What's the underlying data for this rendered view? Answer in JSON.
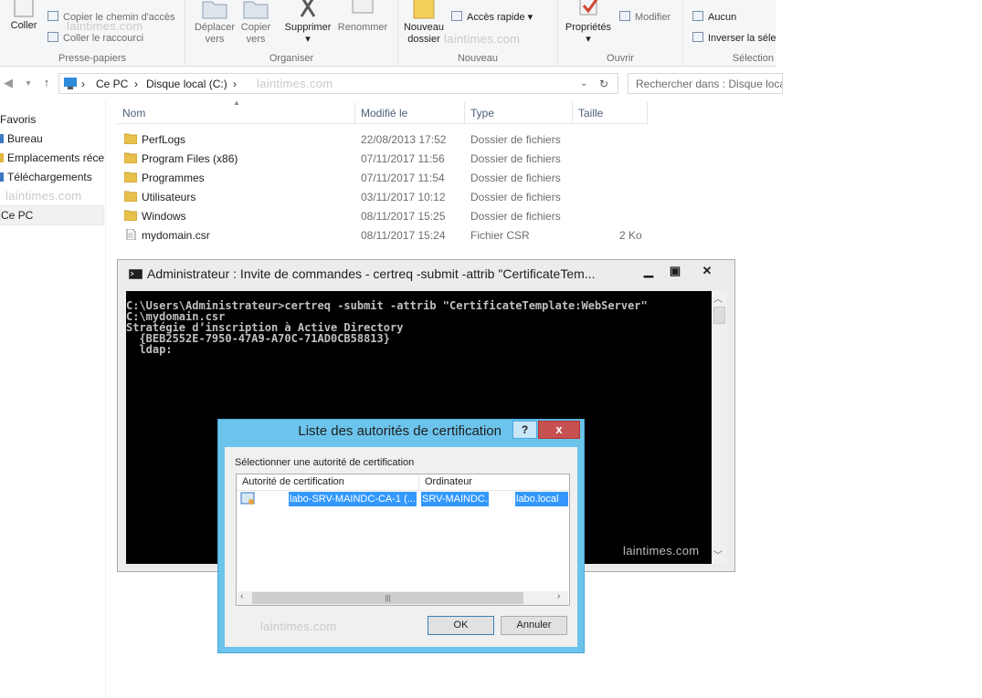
{
  "ribbon": {
    "paste_label": "Coller",
    "copy_path_label": "Copier le chemin d'accès",
    "paste_shortcut_label": "Coller le raccourci",
    "move_to_label": "Déplacer vers",
    "copy_to_label": "Copier vers",
    "delete_label": "Supprimer",
    "rename_label": "Renommer",
    "new_folder_label": "Nouveau dossier",
    "quick_access_label": "Accès rapide",
    "properties_label": "Propriétés",
    "modify_label": "Modifier",
    "select_none_label": "Aucun",
    "invert_selection_label": "Inverser la séle",
    "groups": {
      "clipboard": "Presse-papiers",
      "organize": "Organiser",
      "new": "Nouveau",
      "open": "Ouvrir",
      "selection": "Sélection"
    }
  },
  "watermark": "laintimes.com",
  "address": {
    "crumbs": [
      "Ce PC",
      "Disque local (C:)"
    ],
    "search_placeholder": "Rechercher dans : Disque loca"
  },
  "navpane": {
    "items": [
      "Favoris",
      "Bureau",
      "Emplacements récen",
      "Téléchargements",
      "Ce PC"
    ]
  },
  "filelist": {
    "columns": [
      "Nom",
      "Modifié le",
      "Type",
      "Taille"
    ],
    "rows": [
      {
        "name": "PerfLogs",
        "date": "22/08/2013 17:52",
        "type": "Dossier de fichiers",
        "size": "",
        "kind": "folder"
      },
      {
        "name": "Program Files (x86)",
        "date": "07/11/2017 11:56",
        "type": "Dossier de fichiers",
        "size": "",
        "kind": "folder"
      },
      {
        "name": "Programmes",
        "date": "07/11/2017 11:54",
        "type": "Dossier de fichiers",
        "size": "",
        "kind": "folder"
      },
      {
        "name": "Utilisateurs",
        "date": "03/11/2017 10:12",
        "type": "Dossier de fichiers",
        "size": "",
        "kind": "folder"
      },
      {
        "name": "Windows",
        "date": "08/11/2017 15:25",
        "type": "Dossier de fichiers",
        "size": "",
        "kind": "folder"
      },
      {
        "name": "mydomain.csr",
        "date": "08/11/2017 15:24",
        "type": "Fichier CSR",
        "size": "2 Ko",
        "kind": "file"
      }
    ]
  },
  "cmd": {
    "title": "Administrateur : Invite de commandes - certreq  -submit -attrib \"CertificateTem...",
    "output": "C:\\Users\\Administrateur>certreq -submit -attrib \"CertificateTemplate:WebServer\"\nC:\\mydomain.csr\nStratégie d’inscription à Active Directory\n  {BEB2552E-7950-47A9-A70C-71AD0CB58813}\n  ldap:"
  },
  "dialog": {
    "title": "Liste des autorités de certification",
    "help": "?",
    "close": "x",
    "prompt": "Sélectionner une autorité de certification",
    "columns": [
      "Autorité de certification",
      "Ordinateur"
    ],
    "row": {
      "authority": "labo-SRV-MAINDC-CA-1 (...",
      "computer": "SRV-MAINDC.",
      "domain": "labo.local"
    },
    "ok_label": "OK",
    "cancel_label": "Annuler"
  }
}
